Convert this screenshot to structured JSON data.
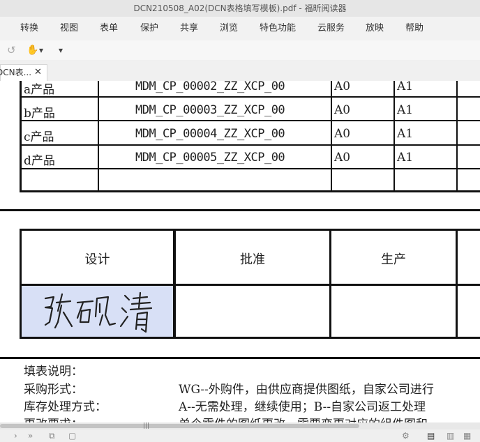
{
  "window": {
    "title": "DCN210508_A02(DCN表格填写模板).pdf - 福昕阅读器"
  },
  "menu": [
    "转换",
    "视图",
    "表单",
    "保护",
    "共享",
    "浏览",
    "特色功能",
    "云服务",
    "放映",
    "帮助"
  ],
  "tab": {
    "label": "DCN表...",
    "close": "✕"
  },
  "toolbar": {
    "undo_icon": "↺",
    "hand_icon": "✋",
    "caret": "▾",
    "more": "▾"
  },
  "products": [
    {
      "name": "a产品",
      "code": "MDM_CP_00002_ZZ_XCP_00",
      "v1": "A0",
      "v2": "A1"
    },
    {
      "name": "b产品",
      "code": "MDM_CP_00003_ZZ_XCP_00",
      "v1": "A0",
      "v2": "A1"
    },
    {
      "name": "c产品",
      "code": "MDM_CP_00004_ZZ_XCP_00",
      "v1": "A0",
      "v2": "A1"
    },
    {
      "name": "d产品",
      "code": "MDM_CP_00005_ZZ_XCP_00",
      "v1": "A0",
      "v2": "A1"
    }
  ],
  "approval": {
    "design": "设计",
    "approve": "批准",
    "production": "生产",
    "signature": "张砚清"
  },
  "notes": {
    "heading": "填表说明：",
    "rows": [
      {
        "label": "采购形式：",
        "text": "WG--外购件，由供应商提供图纸，自家公司进行"
      },
      {
        "label": "库存处理方式：",
        "text": "A--无需处理，继续使用；B--自家公司返工处理"
      },
      {
        "label": "更改要求：",
        "text": "单个零件的图纸更改，需要变更对应的组件图和"
      }
    ]
  },
  "scrollbar": {
    "grip": "|||"
  }
}
